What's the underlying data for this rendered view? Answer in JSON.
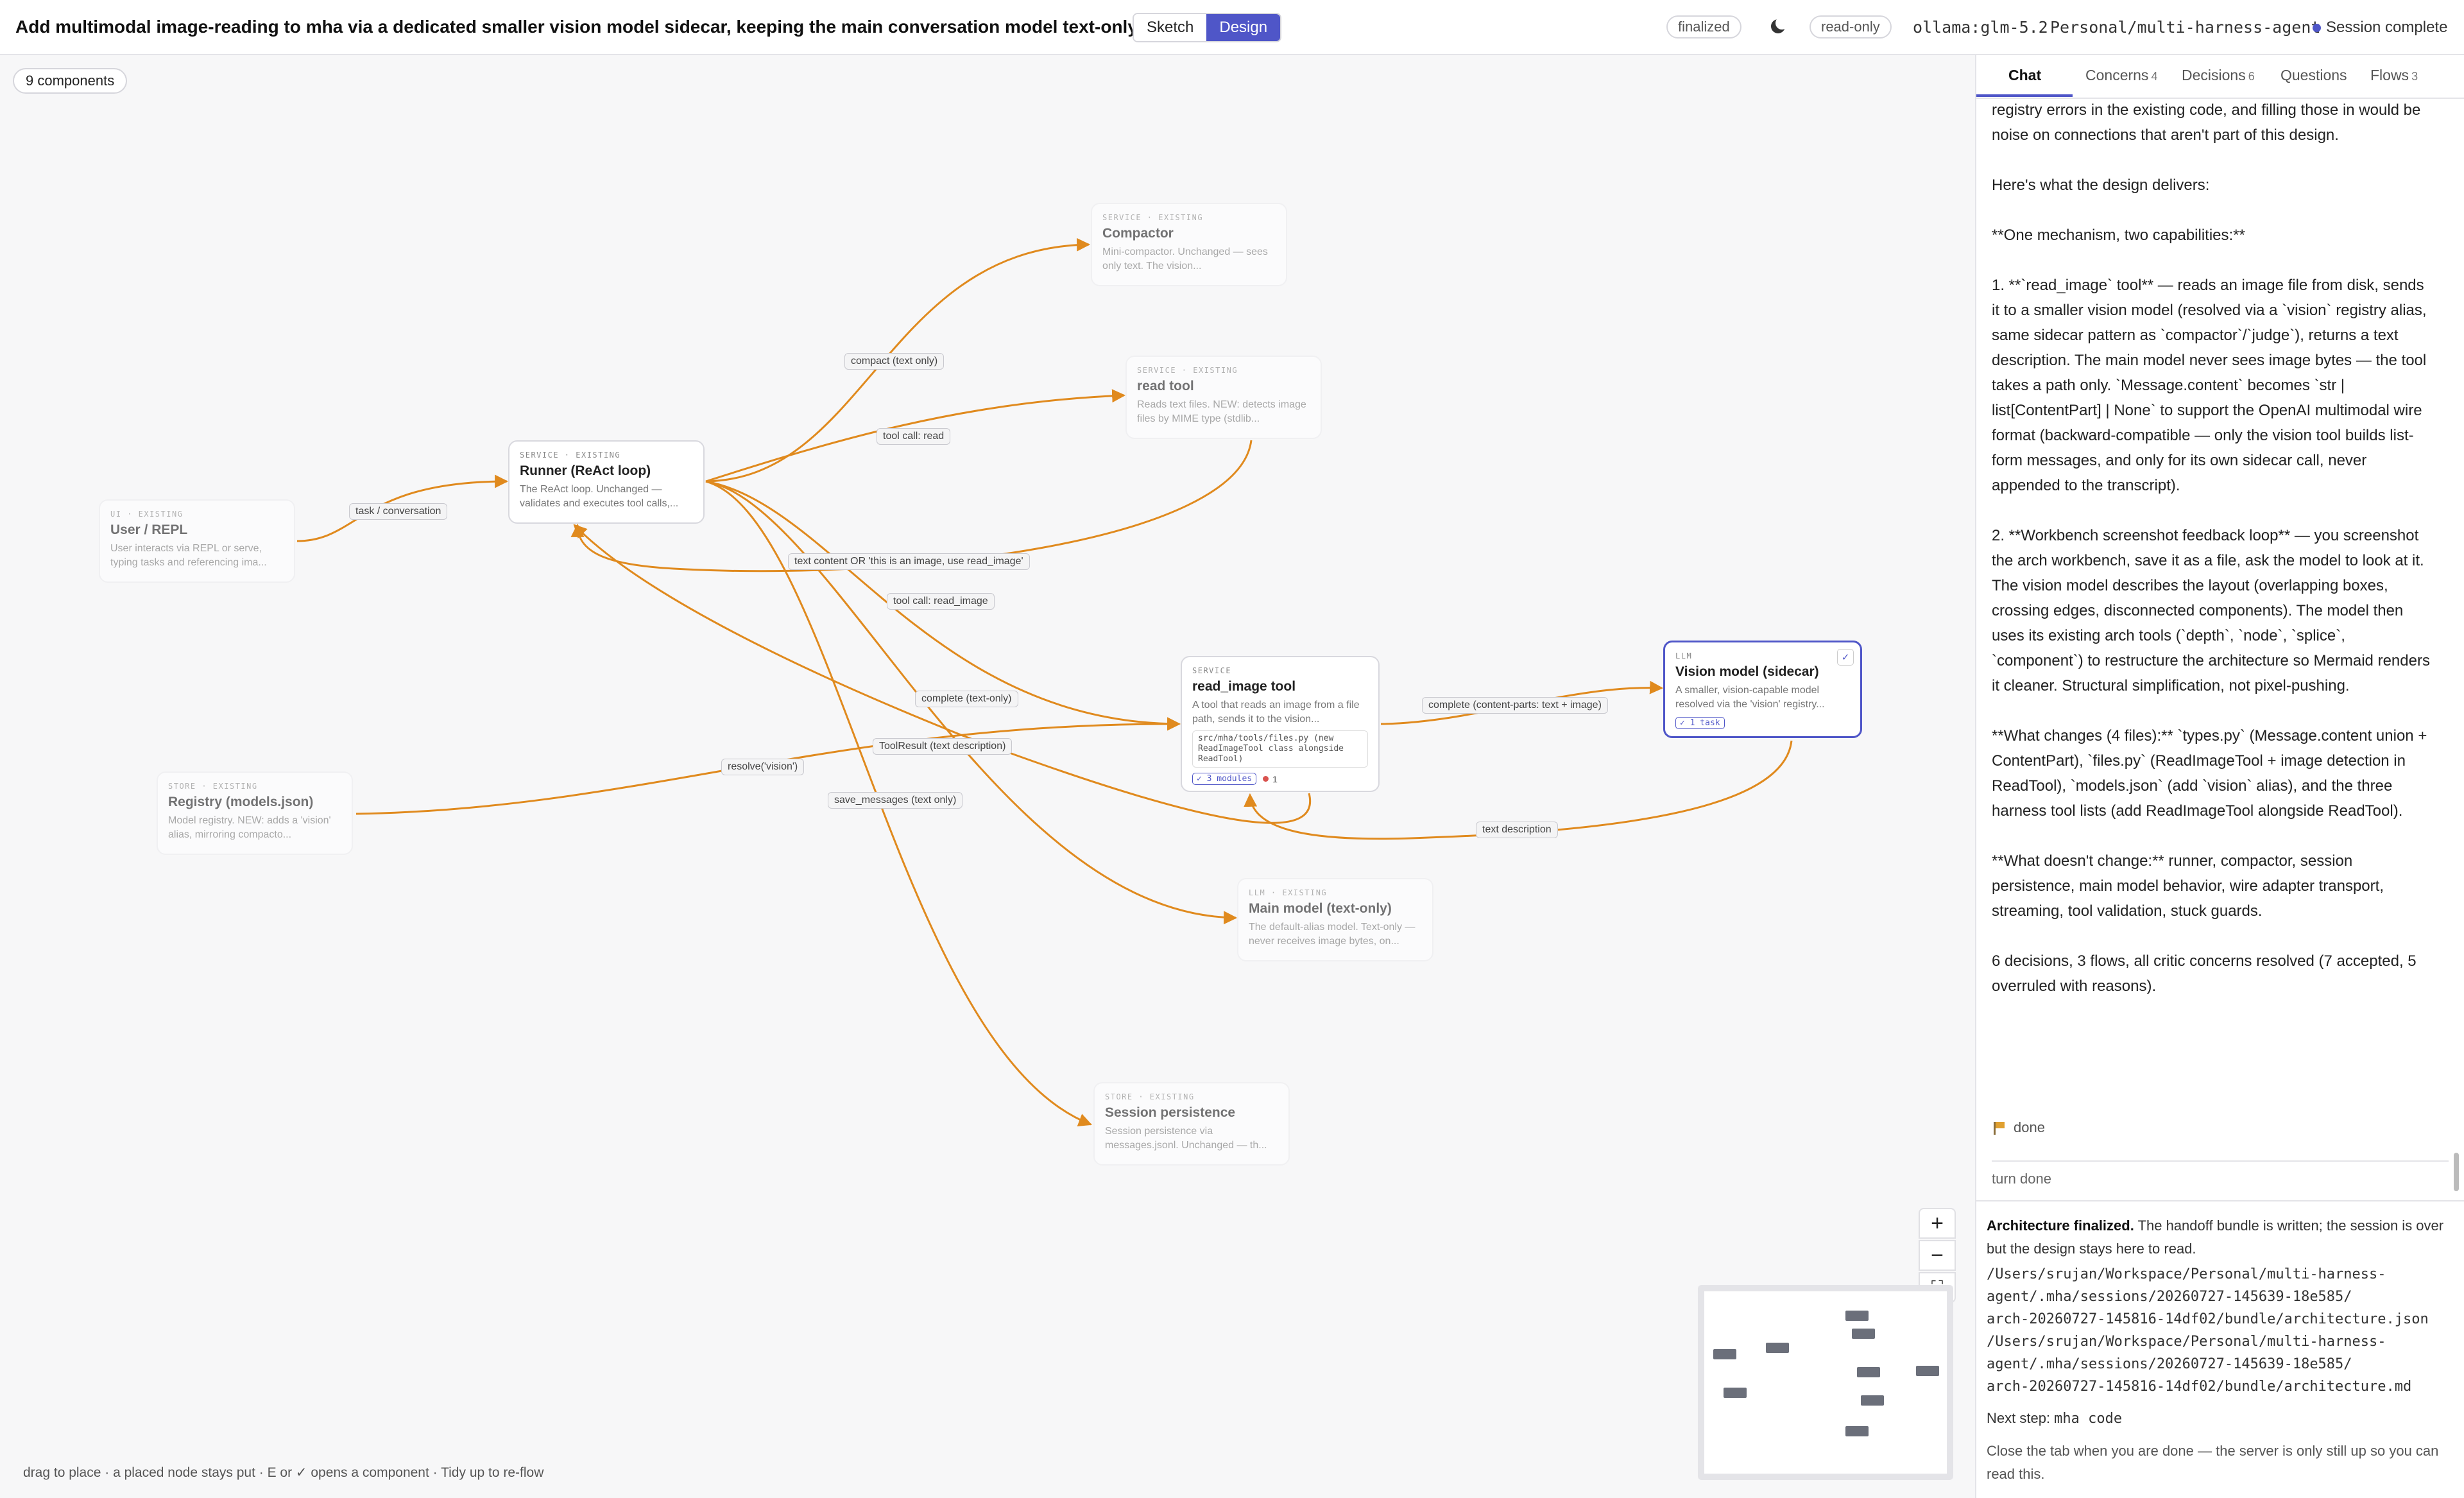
{
  "header": {
    "title": "Add multimodal image-reading to mha via a dedicated smaller vision model sidecar, keeping the main conversation model text-only.",
    "mode_tabs": [
      "Sketch",
      "Design"
    ],
    "active_mode": "Design",
    "finalized_label": "finalized",
    "theme_icon": "moon-icon",
    "readonly_label": "read-only",
    "model": "ollama:glm-5.2",
    "repo": "Personal/multi-harness-agent",
    "session_status": "Session complete",
    "status_color": "#4f56c8"
  },
  "canvas": {
    "component_count": "9 components",
    "edge_color": "#e08a1e",
    "accent_color": "#4f56c8",
    "hint": "drag to place · a placed node stays put · E or ✓ opens a component · Tidy up to re-flow",
    "zoom_controls": [
      "+",
      "−",
      "⛶"
    ]
  },
  "nodes": {
    "compactor": {
      "kind": "SERVICE · EXISTING",
      "name": "Compactor",
      "desc": "Mini-compactor. Unchanged — sees only text. The vision..."
    },
    "read_tool": {
      "kind": "SERVICE · EXISTING",
      "name": "read tool",
      "desc": "Reads text files. NEW: detects image files by MIME type (stdlib..."
    },
    "runner": {
      "kind": "SERVICE · EXISTING",
      "name": "Runner (ReAct loop)",
      "desc": "The ReAct loop. Unchanged — validates and executes tool calls,..."
    },
    "user_repl": {
      "kind": "UI · EXISTING",
      "name": "User / REPL",
      "desc": "User interacts via REPL or serve, typing tasks and referencing ima..."
    },
    "read_image": {
      "kind": "SERVICE",
      "name": "read_image tool",
      "desc": "A tool that reads an image from a file path, sends it to the vision...",
      "file": "src/mha/tools/files.py (new ReadImageTool class alongside ReadTool)",
      "badge_modules": "✓ 3 modules",
      "badge_issues": "1"
    },
    "vision": {
      "kind": "LLM",
      "name": "Vision model (sidecar)",
      "desc": "A smaller, vision-capable model resolved via the 'vision' registry...",
      "badge_task": "✓ 1 task"
    },
    "registry": {
      "kind": "STORE · EXISTING",
      "name": "Registry (models.json)",
      "desc": "Model registry. NEW: adds a 'vision' alias, mirroring compacto..."
    },
    "main_model": {
      "kind": "LLM · EXISTING",
      "name": "Main model (text-only)",
      "desc": "The default-alias model. Text-only — never receives image bytes, on..."
    },
    "session": {
      "kind": "STORE · EXISTING",
      "name": "Session persistence",
      "desc": "Session persistence via messages.jsonl. Unchanged — th..."
    }
  },
  "edges": {
    "task_conversation": "task / conversation",
    "compact": "compact (text only)",
    "tool_call_read": "tool call: read",
    "text_content": "text content OR 'this is an image, use read_image'",
    "tool_call_read_image": "tool call: read_image",
    "complete_text_only": "complete (text-only)",
    "tool_result": "ToolResult (text description)",
    "resolve_vision": "resolve('vision')",
    "save_messages": "save_messages (text only)",
    "complete_content_parts": "complete (content-parts: text + image)",
    "text_description": "text description"
  },
  "panel": {
    "tabs": [
      {
        "label": "Chat",
        "count": ""
      },
      {
        "label": "Concerns",
        "count": "4"
      },
      {
        "label": "Decisions",
        "count": "6"
      },
      {
        "label": "Questions",
        "count": ""
      },
      {
        "label": "Flows",
        "count": "3"
      }
    ],
    "active_tab": "Chat",
    "chat": {
      "p1": "registry errors in the existing code, and filling those in would be noise on connections that aren't part of this design.",
      "p2": "Here's what the design delivers:",
      "p3": "**One mechanism, two capabilities:**",
      "p4": "1. **`read_image` tool** — reads an image file from disk, sends it to a smaller vision model (resolved via a `vision` registry alias, same sidecar pattern as `compactor`/`judge`), returns a text description. The main model never sees image bytes — the tool takes a path only. `Message.content` becomes `str | list[ContentPart] | None` to support the OpenAI multimodal wire format (backward-compatible — only the vision tool builds list-form messages, and only for its own sidecar call, never appended to the transcript).",
      "p5": "2. **Workbench screenshot feedback loop** — you screenshot the arch workbench, save it as a file, ask the model to look at it. The vision model describes the layout (overlapping boxes, crossing edges, disconnected components). The model then uses its existing arch tools (`depth`, `node`, `splice`, `component`) to restructure the architecture so Mermaid renders it cleaner. Structural simplification, not pixel-pushing.",
      "p6": "**What changes (4 files):** `types.py` (Message.content union + ContentPart), `files.py` (ReadImageTool + image detection in ReadTool), `models.json` (add `vision` alias), and the three harness tool lists (add ReadImageTool alongside ReadTool).",
      "p7": "**What doesn't change:** runner, compactor, session persistence, main model behavior, wire adapter transport, streaming, tool validation, stuck guards.",
      "p8": "6 decisions, 3 flows, all critic concerns resolved (7 accepted, 5 overruled with reasons)."
    },
    "done_label": "done",
    "turn_done": "turn done",
    "final": {
      "heading": "Architecture finalized.",
      "text": "The handoff bundle is written; the session is over but the design stays here to read.",
      "paths": [
        "/Users/srujan/Workspace/Personal/multi-harness-",
        "agent/.mha/sessions/20260727-145639-18e585/",
        "arch-20260727-145816-14df02/bundle/architecture.json",
        "/Users/srujan/Workspace/Personal/multi-harness-",
        "agent/.mha/sessions/20260727-145639-18e585/",
        "arch-20260727-145816-14df02/bundle/architecture.md"
      ],
      "next_step_label": "Next step:",
      "next_step_cmd": "mha code",
      "close_note": "Close the tab when you are done — the server is only still up so you can read this."
    }
  }
}
